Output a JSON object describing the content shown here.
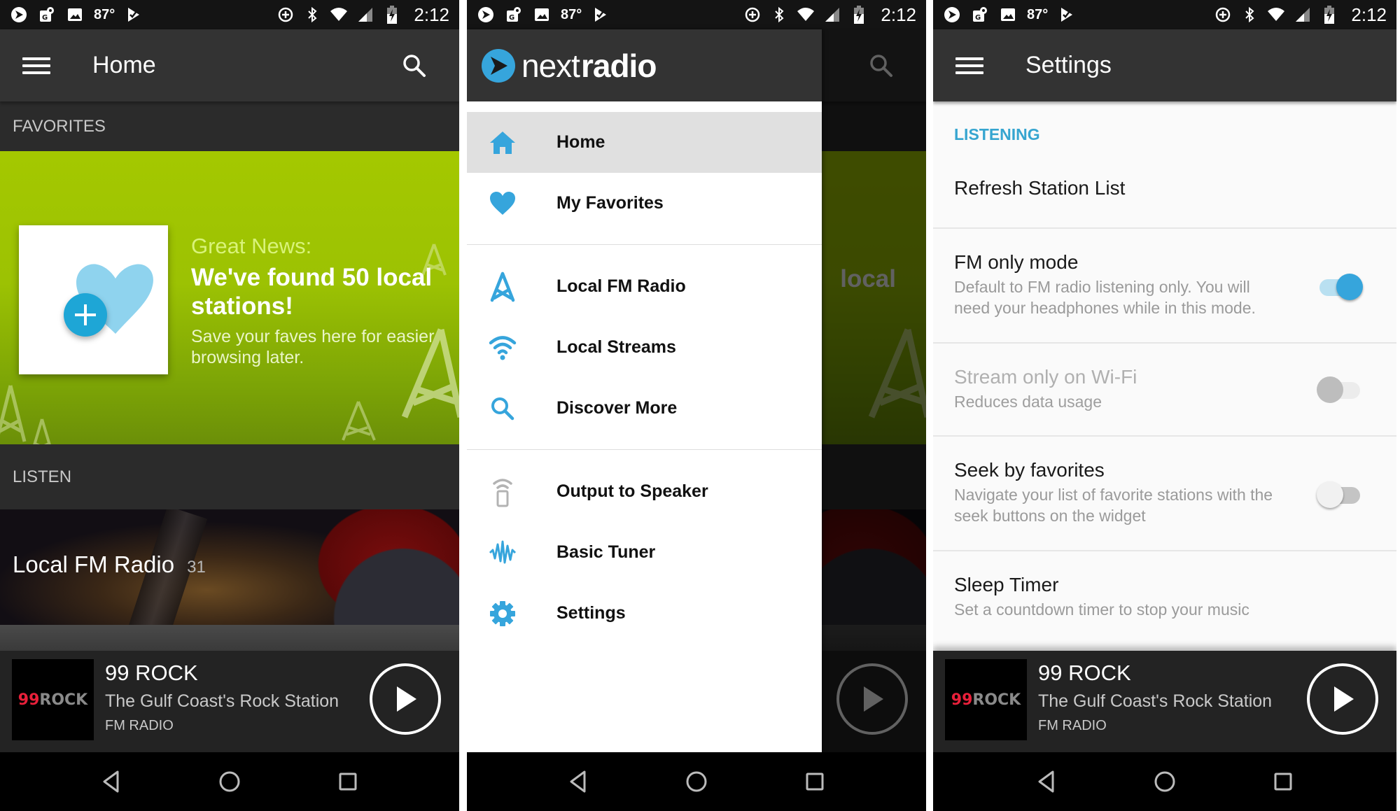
{
  "status_bar": {
    "temperature": "87°",
    "time": "2:12",
    "icons": [
      "nextradio-icon",
      "maps-icon",
      "image-icon",
      "check-flag-icon",
      "data-saver-icon",
      "bluetooth-icon",
      "wifi-icon",
      "signal-icon",
      "battery-charging-icon"
    ]
  },
  "screens": {
    "home": {
      "toolbar": {
        "title": "Home",
        "menu_icon": "hamburger-icon",
        "search_icon": "search-icon"
      },
      "favorites_header": "FAVORITES",
      "banner": {
        "kicker": "Great News:",
        "headline": "We've found 50 local stations!",
        "subtext": "Save your faves here for easier browsing later.",
        "card_icons": [
          "heart-icon",
          "add-icon"
        ]
      },
      "listen_header": "LISTEN",
      "listen_card": {
        "label": "Local FM Radio",
        "count": "31"
      }
    },
    "drawer": {
      "brand_light": "next",
      "brand_bold": "radio",
      "items": [
        {
          "label": "Home",
          "icon": "home-icon",
          "active": true
        },
        {
          "label": "My Favorites",
          "icon": "heart-icon"
        },
        {
          "label": "Local FM Radio",
          "icon": "radio-tower-icon"
        },
        {
          "label": "Local Streams",
          "icon": "wifi-icon"
        },
        {
          "label": "Discover More",
          "icon": "search-icon"
        },
        {
          "label": "Output to Speaker",
          "icon": "speaker-output-icon"
        },
        {
          "label": "Basic Tuner",
          "icon": "waveform-icon"
        },
        {
          "label": "Settings",
          "icon": "gear-icon"
        }
      ]
    },
    "settings": {
      "toolbar": {
        "title": "Settings",
        "menu_icon": "hamburger-icon"
      },
      "section": "LISTENING",
      "rows": [
        {
          "title": "Refresh Station List"
        },
        {
          "title": "FM only mode",
          "description": "Default to FM radio listening only. You will need your headphones while in this mode.",
          "toggle": "on"
        },
        {
          "title": "Stream only on Wi-Fi",
          "description": "Reduces data usage",
          "toggle": "off",
          "disabled": true
        },
        {
          "title": "Seek by favorites",
          "description": "Navigate your list of favorite stations with the seek buttons on the widget",
          "toggle": "off"
        },
        {
          "title": "Sleep Timer",
          "description": "Set a countdown timer to stop your music"
        }
      ]
    }
  },
  "now_playing": {
    "logo_number": "99",
    "logo_word": "ROCK",
    "station_name": "99 ROCK",
    "tagline": "The Gulf Coast's Rock Station",
    "source": "FM RADIO",
    "play_icon": "play-icon"
  },
  "nav_bar": {
    "back": "back-icon",
    "home": "home-circle-icon",
    "recents": "recents-icon"
  },
  "colors": {
    "accent_blue": "#36a5dc",
    "banner_green": "#9cc203",
    "toolbar": "#333333",
    "logo_red": "#e8203a"
  }
}
